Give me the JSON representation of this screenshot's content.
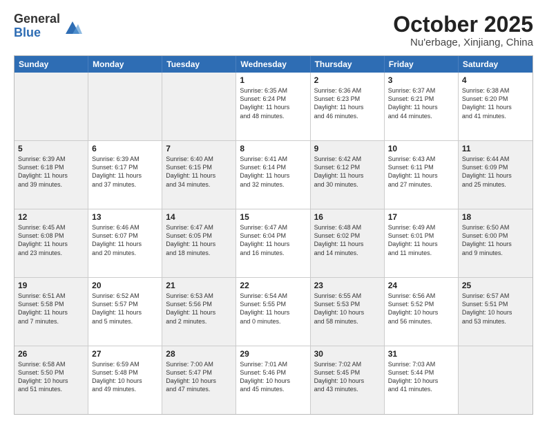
{
  "logo": {
    "general": "General",
    "blue": "Blue"
  },
  "title": "October 2025",
  "location": "Nu'erbage, Xinjiang, China",
  "header_days": [
    "Sunday",
    "Monday",
    "Tuesday",
    "Wednesday",
    "Thursday",
    "Friday",
    "Saturday"
  ],
  "weeks": [
    [
      {
        "day": "",
        "info": "",
        "shaded": true
      },
      {
        "day": "",
        "info": "",
        "shaded": true
      },
      {
        "day": "",
        "info": "",
        "shaded": true
      },
      {
        "day": "1",
        "info": "Sunrise: 6:35 AM\nSunset: 6:24 PM\nDaylight: 11 hours\nand 48 minutes."
      },
      {
        "day": "2",
        "info": "Sunrise: 6:36 AM\nSunset: 6:23 PM\nDaylight: 11 hours\nand 46 minutes."
      },
      {
        "day": "3",
        "info": "Sunrise: 6:37 AM\nSunset: 6:21 PM\nDaylight: 11 hours\nand 44 minutes."
      },
      {
        "day": "4",
        "info": "Sunrise: 6:38 AM\nSunset: 6:20 PM\nDaylight: 11 hours\nand 41 minutes."
      }
    ],
    [
      {
        "day": "5",
        "info": "Sunrise: 6:39 AM\nSunset: 6:18 PM\nDaylight: 11 hours\nand 39 minutes.",
        "shaded": true
      },
      {
        "day": "6",
        "info": "Sunrise: 6:39 AM\nSunset: 6:17 PM\nDaylight: 11 hours\nand 37 minutes."
      },
      {
        "day": "7",
        "info": "Sunrise: 6:40 AM\nSunset: 6:15 PM\nDaylight: 11 hours\nand 34 minutes.",
        "shaded": true
      },
      {
        "day": "8",
        "info": "Sunrise: 6:41 AM\nSunset: 6:14 PM\nDaylight: 11 hours\nand 32 minutes."
      },
      {
        "day": "9",
        "info": "Sunrise: 6:42 AM\nSunset: 6:12 PM\nDaylight: 11 hours\nand 30 minutes.",
        "shaded": true
      },
      {
        "day": "10",
        "info": "Sunrise: 6:43 AM\nSunset: 6:11 PM\nDaylight: 11 hours\nand 27 minutes."
      },
      {
        "day": "11",
        "info": "Sunrise: 6:44 AM\nSunset: 6:09 PM\nDaylight: 11 hours\nand 25 minutes.",
        "shaded": true
      }
    ],
    [
      {
        "day": "12",
        "info": "Sunrise: 6:45 AM\nSunset: 6:08 PM\nDaylight: 11 hours\nand 23 minutes.",
        "shaded": true
      },
      {
        "day": "13",
        "info": "Sunrise: 6:46 AM\nSunset: 6:07 PM\nDaylight: 11 hours\nand 20 minutes."
      },
      {
        "day": "14",
        "info": "Sunrise: 6:47 AM\nSunset: 6:05 PM\nDaylight: 11 hours\nand 18 minutes.",
        "shaded": true
      },
      {
        "day": "15",
        "info": "Sunrise: 6:47 AM\nSunset: 6:04 PM\nDaylight: 11 hours\nand 16 minutes."
      },
      {
        "day": "16",
        "info": "Sunrise: 6:48 AM\nSunset: 6:02 PM\nDaylight: 11 hours\nand 14 minutes.",
        "shaded": true
      },
      {
        "day": "17",
        "info": "Sunrise: 6:49 AM\nSunset: 6:01 PM\nDaylight: 11 hours\nand 11 minutes."
      },
      {
        "day": "18",
        "info": "Sunrise: 6:50 AM\nSunset: 6:00 PM\nDaylight: 11 hours\nand 9 minutes.",
        "shaded": true
      }
    ],
    [
      {
        "day": "19",
        "info": "Sunrise: 6:51 AM\nSunset: 5:58 PM\nDaylight: 11 hours\nand 7 minutes.",
        "shaded": true
      },
      {
        "day": "20",
        "info": "Sunrise: 6:52 AM\nSunset: 5:57 PM\nDaylight: 11 hours\nand 5 minutes."
      },
      {
        "day": "21",
        "info": "Sunrise: 6:53 AM\nSunset: 5:56 PM\nDaylight: 11 hours\nand 2 minutes.",
        "shaded": true
      },
      {
        "day": "22",
        "info": "Sunrise: 6:54 AM\nSunset: 5:55 PM\nDaylight: 11 hours\nand 0 minutes."
      },
      {
        "day": "23",
        "info": "Sunrise: 6:55 AM\nSunset: 5:53 PM\nDaylight: 10 hours\nand 58 minutes.",
        "shaded": true
      },
      {
        "day": "24",
        "info": "Sunrise: 6:56 AM\nSunset: 5:52 PM\nDaylight: 10 hours\nand 56 minutes."
      },
      {
        "day": "25",
        "info": "Sunrise: 6:57 AM\nSunset: 5:51 PM\nDaylight: 10 hours\nand 53 minutes.",
        "shaded": true
      }
    ],
    [
      {
        "day": "26",
        "info": "Sunrise: 6:58 AM\nSunset: 5:50 PM\nDaylight: 10 hours\nand 51 minutes.",
        "shaded": true
      },
      {
        "day": "27",
        "info": "Sunrise: 6:59 AM\nSunset: 5:48 PM\nDaylight: 10 hours\nand 49 minutes."
      },
      {
        "day": "28",
        "info": "Sunrise: 7:00 AM\nSunset: 5:47 PM\nDaylight: 10 hours\nand 47 minutes.",
        "shaded": true
      },
      {
        "day": "29",
        "info": "Sunrise: 7:01 AM\nSunset: 5:46 PM\nDaylight: 10 hours\nand 45 minutes."
      },
      {
        "day": "30",
        "info": "Sunrise: 7:02 AM\nSunset: 5:45 PM\nDaylight: 10 hours\nand 43 minutes.",
        "shaded": true
      },
      {
        "day": "31",
        "info": "Sunrise: 7:03 AM\nSunset: 5:44 PM\nDaylight: 10 hours\nand 41 minutes."
      },
      {
        "day": "",
        "info": "",
        "shaded": true
      }
    ]
  ]
}
